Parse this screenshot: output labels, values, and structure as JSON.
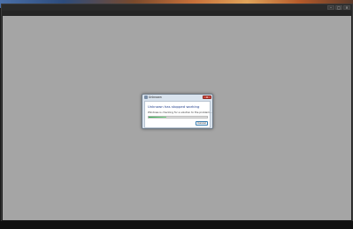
{
  "app_window": {
    "title": "",
    "menu": [
      "",
      "",
      ""
    ]
  },
  "dialog": {
    "title": "Unknown",
    "heading": "Unknown has stopped working",
    "message": "Windows is checking for a solution to the problem...",
    "progress": 0.3,
    "cancel_label": "Cancel",
    "close_glyph": "x"
  },
  "colors": {
    "content_background": "#a5a5a5",
    "dialog_heading": "#1e3c8c",
    "progress_fill": "#2bb24c",
    "close_button": "#c94a3f"
  }
}
